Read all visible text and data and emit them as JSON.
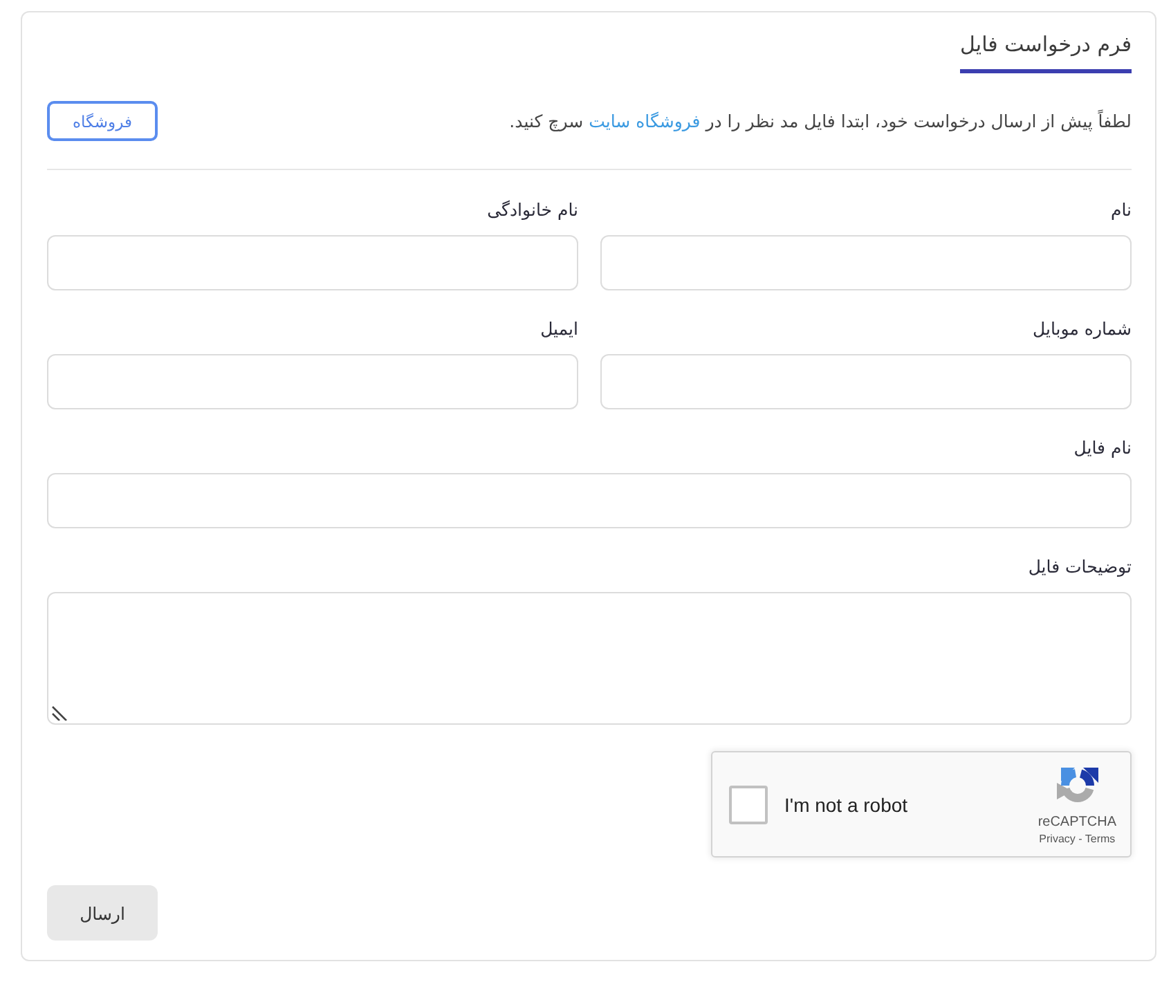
{
  "form": {
    "title": "فرم درخواست فایل",
    "notice": {
      "text": "لطفاً پیش از ارسال درخواست خود، ابتدا فایل مد نظر را در",
      "link": "فروشگاه سایت",
      "text_end": "سرچ کنید."
    },
    "store_button": "فروشگاه",
    "fields": [
      {
        "label": "نام",
        "kind": "half"
      },
      {
        "label": "نام خانوادگی",
        "kind": "half"
      },
      {
        "label": "شماره موبایل",
        "kind": "half"
      },
      {
        "label": "ایمیل",
        "kind": "half"
      },
      {
        "label": "نام فایل",
        "kind": "full"
      },
      {
        "label": "توضیحات فایل",
        "kind": "textarea"
      }
    ],
    "captcha": {
      "checked": false,
      "label": "I'm not a robot",
      "brand": "reCAPTCHA",
      "links": "Privacy - Terms"
    },
    "submit_button": "ارسال"
  }
}
